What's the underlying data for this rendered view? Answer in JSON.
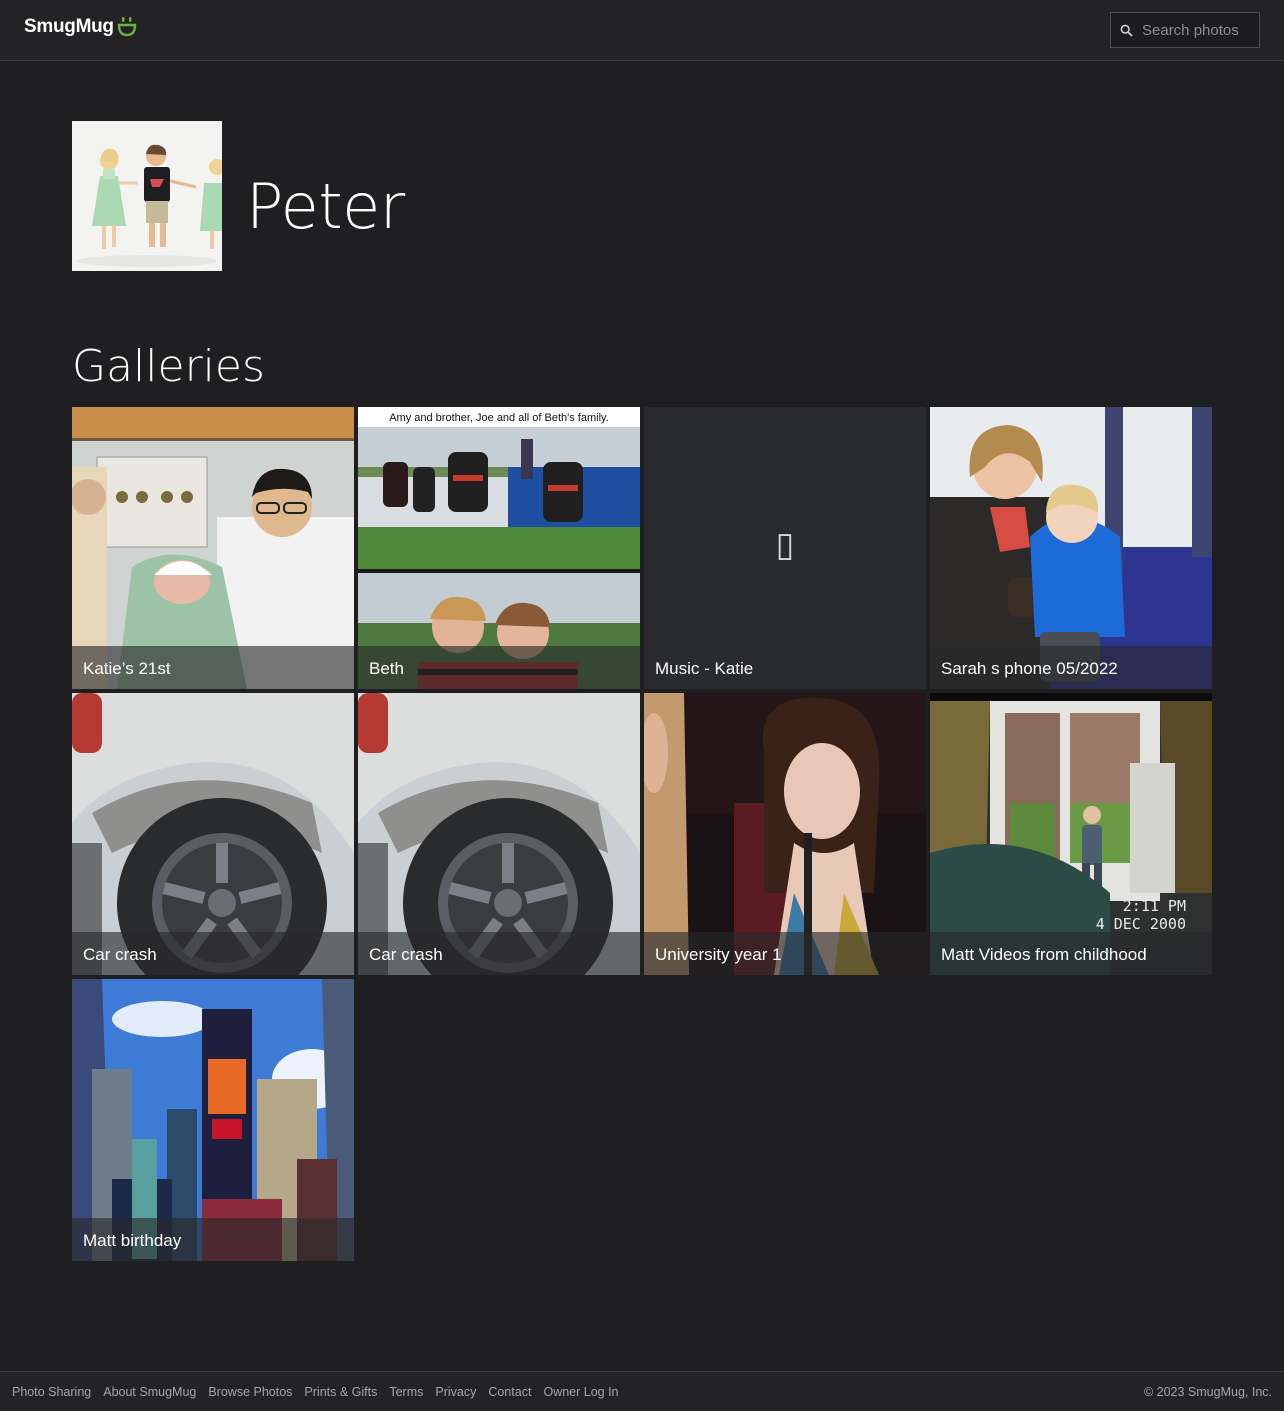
{
  "header": {
    "logo_text": "SmugMug",
    "search_placeholder": "Search photos",
    "accent_color": "#6db33f"
  },
  "profile": {
    "name": "Peter"
  },
  "galleries_section": {
    "title": "Galleries",
    "items": [
      {
        "label": "Katie’s 21st"
      },
      {
        "label": "Beth",
        "image_text": "Amy and brother, Joe and all of Beth's family."
      },
      {
        "label": "Music - Katie",
        "icon": "image-placeholder-icon"
      },
      {
        "label": "Sarah s phone 05/2022"
      },
      {
        "label": "Car crash"
      },
      {
        "label": "Car crash"
      },
      {
        "label": "University year 1"
      },
      {
        "label": "Matt Videos from childhood",
        "image_text": [
          "2:11 PM",
          "4 DEC 2000"
        ]
      },
      {
        "label": "Matt birthday"
      }
    ]
  },
  "footer": {
    "links": [
      "Photo Sharing",
      "About SmugMug",
      "Browse Photos",
      "Prints & Gifts",
      "Terms",
      "Privacy",
      "Contact",
      "Owner Log In"
    ],
    "copyright": "© 2023 SmugMug, Inc."
  }
}
